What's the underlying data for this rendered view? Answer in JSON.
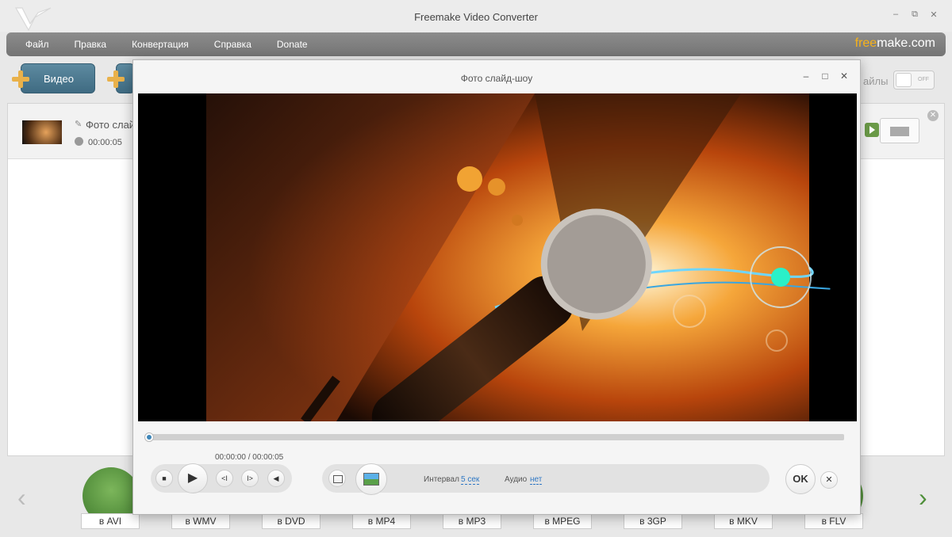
{
  "window": {
    "title": "Freemake Video Converter",
    "controls": {
      "minimize": "–",
      "restore": "⧉",
      "close": "✕"
    }
  },
  "menu": {
    "items": [
      {
        "label": "Файл"
      },
      {
        "label": "Правка"
      },
      {
        "label": "Конвертация"
      },
      {
        "label": "Справка"
      },
      {
        "label": "Donate"
      }
    ],
    "brand_part1": "free",
    "brand_part2": "make.com"
  },
  "toolbar": {
    "video_label": "Видео",
    "files_label": "айлы",
    "toggle_label": "OFF"
  },
  "file_item": {
    "name": "Фото слай",
    "duration": "00:00:05"
  },
  "formats": {
    "items": [
      {
        "label": "в AVI"
      },
      {
        "label": "в WMV"
      },
      {
        "label": "в DVD"
      },
      {
        "label": "в MP4"
      },
      {
        "label": "в MP3"
      },
      {
        "label": "в MPEG"
      },
      {
        "label": "в 3GP"
      },
      {
        "label": "в MKV"
      },
      {
        "label": "в FLV"
      }
    ]
  },
  "dialog": {
    "title": "Фото слайд-шоу",
    "controls": {
      "minimize": "–",
      "maximize": "□",
      "close": "✕"
    },
    "timecode": "00:00:00 / 00:00:05",
    "progress": 0,
    "player": {
      "stop": "■",
      "play": "▶",
      "prev": "<I",
      "next": "I>",
      "volume": "◀"
    },
    "interval_label": "Интервал",
    "interval_value": "5 сек",
    "audio_label": "Аудио",
    "audio_value": "нет",
    "ok_label": "OK",
    "cancel_label": "✕"
  },
  "colors": {
    "accent_blue": "#2e77c4",
    "brand_orange": "#f6b21a",
    "format_green": "#4f8f3a"
  }
}
